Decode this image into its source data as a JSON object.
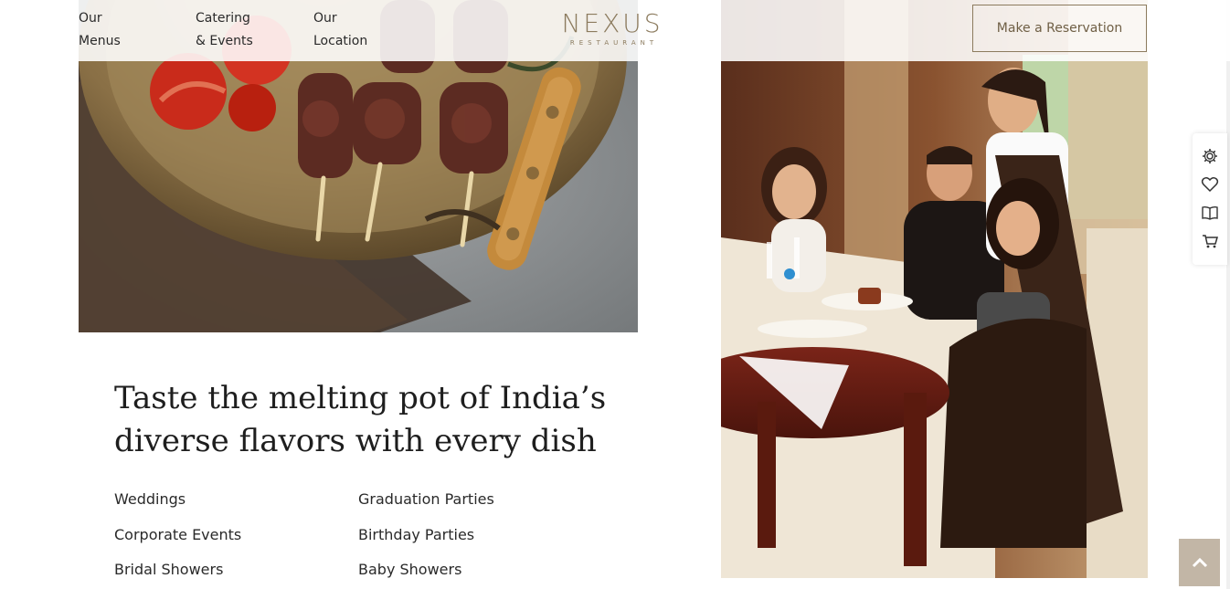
{
  "nav": {
    "menus": [
      "Our",
      "Menus"
    ],
    "catering": [
      "Catering",
      "& Events"
    ],
    "location": [
      "Our",
      "Location"
    ]
  },
  "logo": {
    "main": "NEXUS",
    "sub": "RESTAURANT"
  },
  "reserve_label": "Make a Reservation",
  "headline": [
    "Taste the melting pot of India’s",
    "diverse flavors with every dish"
  ],
  "events": {
    "left": [
      "Weddings",
      "Corporate Events",
      "Bridal Showers"
    ],
    "right": [
      "Graduation Parties",
      "Birthday Parties",
      "Baby Showers"
    ]
  },
  "icons": {
    "tools": [
      "settings-icon",
      "heart-icon",
      "book-icon",
      "cart-icon"
    ],
    "to_top": "arrow-up-icon"
  },
  "colors": {
    "accent": "#8c7b5e",
    "to_top_bg": "#c2b6a6"
  }
}
